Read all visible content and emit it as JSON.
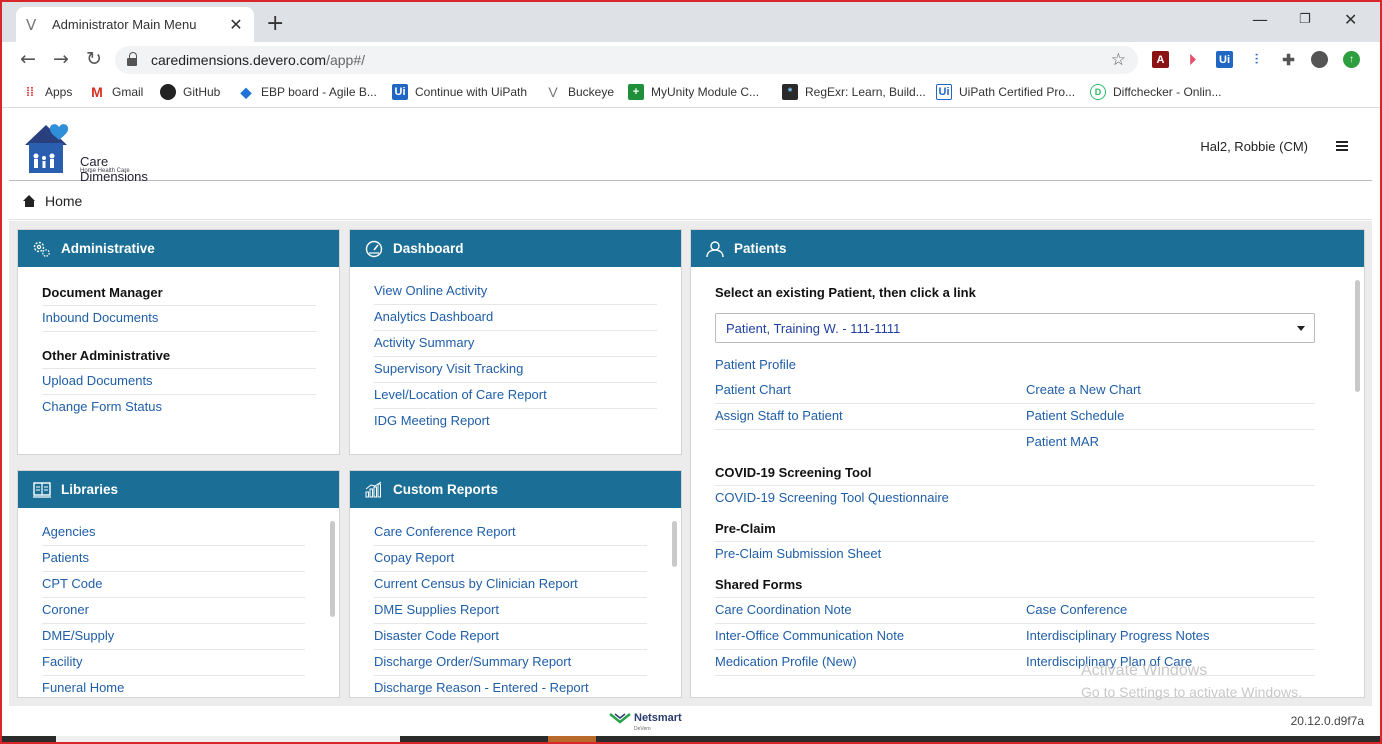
{
  "browser": {
    "tab_title": "Administrator Main Menu",
    "url_host": "caredimensions.devero.com",
    "url_path": "/app#/",
    "bookmarks": [
      {
        "label": "Apps",
        "icon": "apps-grid-icon"
      },
      {
        "label": "Gmail",
        "icon": "gmail-icon"
      },
      {
        "label": "GitHub",
        "icon": "github-icon"
      },
      {
        "label": "EBP board - Agile B...",
        "icon": "azure-boards-icon"
      },
      {
        "label": "Continue with UiPath",
        "icon": "uipath-icon"
      },
      {
        "label": "Buckeye",
        "icon": "devero-v-icon"
      },
      {
        "label": "MyUnity Module C...",
        "icon": "myunity-icon"
      },
      {
        "label": "RegExr: Learn, Build...",
        "icon": "regexr-icon"
      },
      {
        "label": "UiPath Certified Pro...",
        "icon": "uipath-icon"
      },
      {
        "label": "Diffchecker - Onlin...",
        "icon": "diffchecker-icon"
      }
    ]
  },
  "header": {
    "logo_name": "Care Dimensions",
    "logo_sub": "Home Health Care",
    "user": "Hal2, Robbie (CM)"
  },
  "breadcrumb": {
    "home": "Home"
  },
  "administrative": {
    "title": "Administrative",
    "sections": [
      {
        "title": "Document Manager",
        "links": [
          "Inbound Documents"
        ]
      },
      {
        "title": "Other Administrative",
        "links": [
          "Upload Documents",
          "Change Form Status"
        ]
      }
    ]
  },
  "dashboard": {
    "title": "Dashboard",
    "links": [
      "View Online Activity",
      "Analytics Dashboard",
      "Activity Summary",
      "Supervisory Visit Tracking",
      "Level/Location of Care Report",
      "IDG Meeting Report"
    ]
  },
  "libraries": {
    "title": "Libraries",
    "links": [
      "Agencies",
      "Patients",
      "CPT Code",
      "Coroner",
      "DME/Supply",
      "Facility",
      "Funeral Home"
    ]
  },
  "custom_reports": {
    "title": "Custom Reports",
    "links": [
      "Care Conference Report",
      "Copay Report",
      "Current Census by Clinician Report",
      "DME Supplies Report",
      "Disaster Code Report",
      "Discharge Order/Summary Report",
      "Discharge Reason - Entered - Report"
    ]
  },
  "patients": {
    "title": "Patients",
    "instruction": "Select an existing Patient, then click a link",
    "selected_patient": "Patient, Training W. - 111-1111",
    "profile": "Patient Profile",
    "rows": [
      [
        "Patient Chart",
        "Create a New Chart"
      ],
      [
        "Assign Staff to Patient",
        "Patient Schedule"
      ],
      [
        "",
        "Patient MAR"
      ]
    ],
    "covid_title": "COVID-19 Screening Tool",
    "covid_link": "COVID-19 Screening Tool Questionnaire",
    "preclaim_title": "Pre-Claim",
    "preclaim_link": "Pre-Claim Submission Sheet",
    "shared_title": "Shared Forms",
    "shared_rows": [
      [
        "Care Coordination Note",
        "Case Conference"
      ],
      [
        "Inter-Office Communication Note",
        "Interdisciplinary Progress Notes"
      ],
      [
        "Medication Profile (New)",
        "Interdisciplinary Plan of Care"
      ]
    ]
  },
  "watermark": {
    "line1": "Activate Windows",
    "line2": "Go to Settings to activate Windows."
  },
  "footer": {
    "brand": "Netsmart",
    "brand_sub": "DeVero",
    "version": "20.12.0.d9f7a"
  },
  "colors": {
    "panel_header": "#1b6f96",
    "link": "#1f5ea8",
    "frame": "#d8262b"
  }
}
